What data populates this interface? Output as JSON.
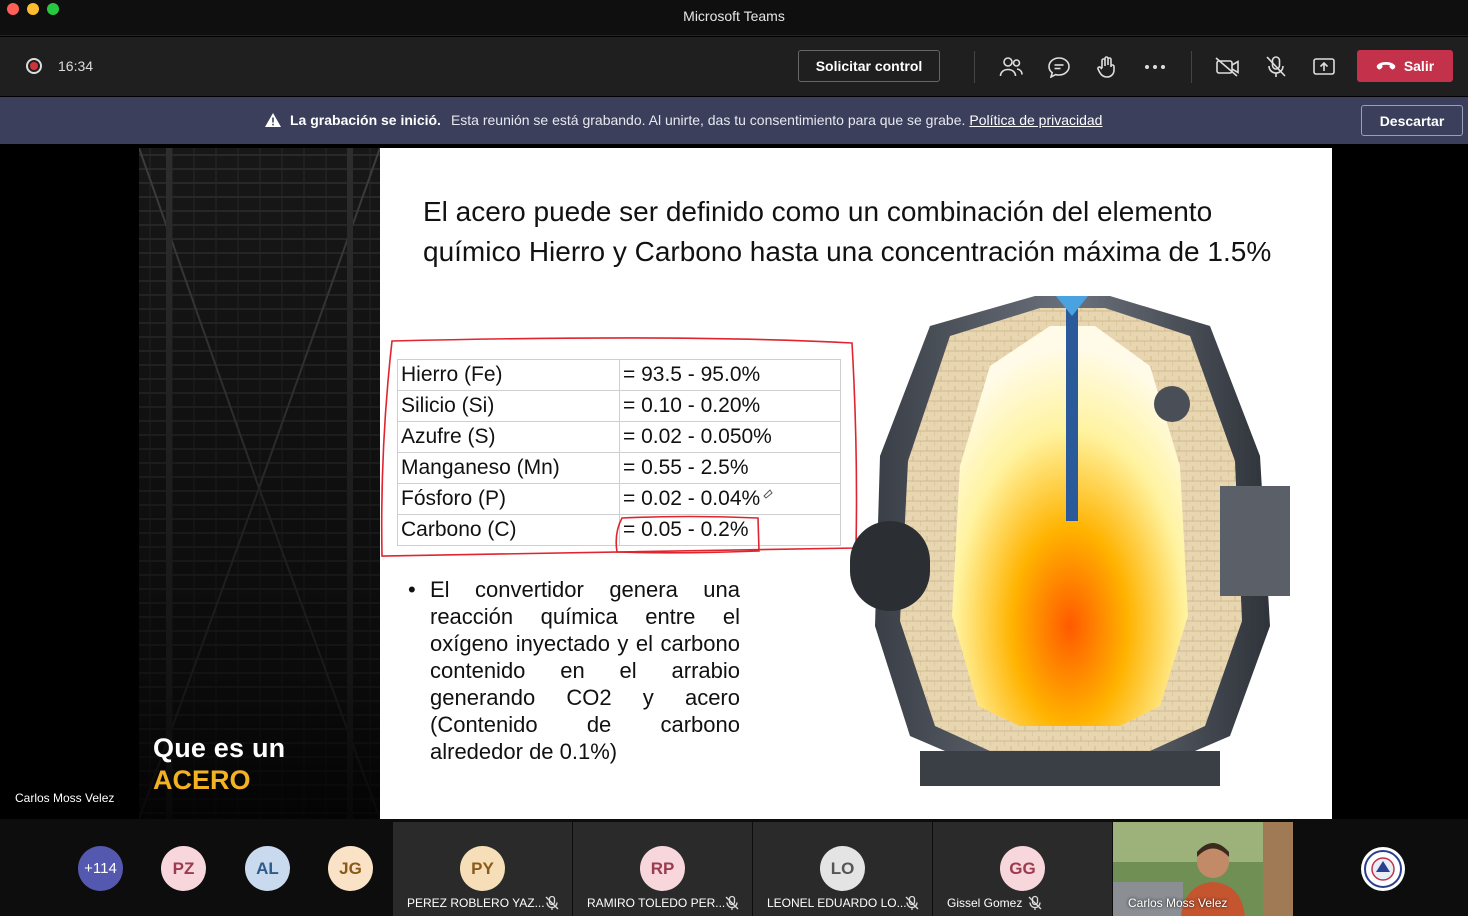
{
  "window": {
    "title": "Microsoft Teams"
  },
  "toolbar": {
    "timer": "16:34",
    "request_control": "Solicitar control",
    "leave": "Salir"
  },
  "banner": {
    "bold": "La grabación se inició.",
    "message": "Esta reunión se está grabando. Al unirte, das tu consentimiento para que se grabe.",
    "link": "Política de privacidad",
    "dismiss": "Descartar"
  },
  "stage": {
    "presenter": "Carlos Moss Velez",
    "cover_line1": "Que es un",
    "cover_line2": "ACERO"
  },
  "slide": {
    "title": "El acero puede ser definido como un combinación del elemento químico Hierro y Carbono hasta una concentración máxima de 1.5%",
    "table": [
      {
        "element": "Hierro (Fe)",
        "range": "= 93.5 - 95.0%"
      },
      {
        "element": "Silicio (Si)",
        "range": "= 0.10 - 0.20%"
      },
      {
        "element": "Azufre (S)",
        "range": "= 0.02 - 0.050%"
      },
      {
        "element": "Manganeso (Mn)",
        "range": "= 0.55 - 2.5%"
      },
      {
        "element": "Fósforo (P)",
        "range": "= 0.02 - 0.04%"
      },
      {
        "element": "Carbono (C)",
        "range": "= 0.05 - 0.2%"
      }
    ],
    "bullet": "El convertidor genera una reacción química entre el oxígeno inyectado y el carbono contenido en el arrabio generando CO2 y acero (Contenido de carbono alrededor de 0.1%)"
  },
  "participants": {
    "overflow": "+114",
    "avatars": [
      {
        "initials": "PZ",
        "bg": "#f7d6dc",
        "fg": "#9b3b4f"
      },
      {
        "initials": "AL",
        "bg": "#c9d9ee",
        "fg": "#2f5a8a"
      },
      {
        "initials": "JG",
        "bg": "#f9e2c6",
        "fg": "#8a5a1a"
      }
    ],
    "tiles": [
      {
        "initials": "PY",
        "name": "PEREZ ROBLERO YAZ...",
        "bg": "#f6dfb8",
        "fg": "#8a5a1a"
      },
      {
        "initials": "RP",
        "name": "RAMIRO TOLEDO PER...",
        "bg": "#f7d6dc",
        "fg": "#9b3b4f"
      },
      {
        "initials": "LO",
        "name": "LEONEL EDUARDO LO...",
        "bg": "#e4e4e4",
        "fg": "#555555"
      },
      {
        "initials": "GG",
        "name": "Gissel Gomez",
        "bg": "#f7d6dc",
        "fg": "#9b3b4f"
      }
    ],
    "video_name": "Carlos Moss Velez"
  },
  "colors": {
    "accent_red": "#c4314b",
    "banner_bg": "#3b3f5c",
    "cover_accent": "#f4b223",
    "annotation_red": "#e0252e",
    "overflow_avatar": "#5558af"
  }
}
